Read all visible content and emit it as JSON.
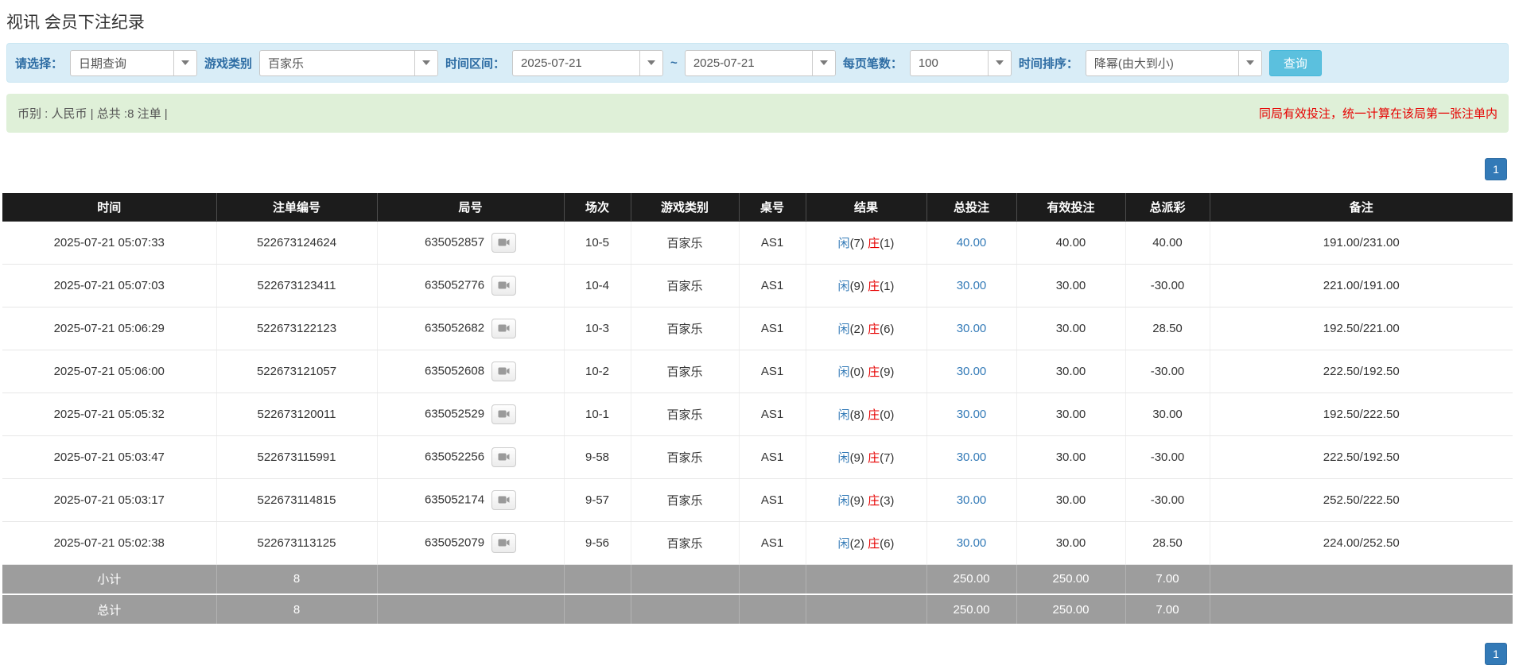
{
  "page": {
    "title": "视讯 会员下注纪录"
  },
  "filters": {
    "select_label": "请选择：",
    "select_value": "日期查询",
    "game_type_label": "游戏类别",
    "game_type_value": "百家乐",
    "date_range_label": "时间区间：",
    "date_from": "2025-07-21",
    "tilde": "~",
    "date_to": "2025-07-21",
    "page_size_label": "每页笔数：",
    "page_size_value": "100",
    "sort_label": "时间排序：",
    "sort_value": "降幂(由大到小)",
    "search_button": "查询"
  },
  "summary": {
    "left": "币别 : 人民币 | 总共 :8 注单 |",
    "right": "同局有效投注，统一计算在该局第一张注单内"
  },
  "pagination": {
    "page": "1"
  },
  "table": {
    "headers": [
      "时间",
      "注单编号",
      "局号",
      "场次",
      "游戏类别",
      "桌号",
      "结果",
      "总投注",
      "有效投注",
      "总派彩",
      "备注"
    ],
    "rows": [
      {
        "time": "2025-07-21 05:07:33",
        "bet_id": "522673124624",
        "round_id": "635052857",
        "session": "10-5",
        "game": "百家乐",
        "table_no": "AS1",
        "player": "闲",
        "player_score": "(7)",
        "banker": "庄",
        "banker_score": "(1)",
        "total_bet": "40.00",
        "valid_bet": "40.00",
        "payout": "40.00",
        "note": "191.00/231.00"
      },
      {
        "time": "2025-07-21 05:07:03",
        "bet_id": "522673123411",
        "round_id": "635052776",
        "session": "10-4",
        "game": "百家乐",
        "table_no": "AS1",
        "player": "闲",
        "player_score": "(9)",
        "banker": "庄",
        "banker_score": "(1)",
        "total_bet": "30.00",
        "valid_bet": "30.00",
        "payout": "-30.00",
        "note": "221.00/191.00"
      },
      {
        "time": "2025-07-21 05:06:29",
        "bet_id": "522673122123",
        "round_id": "635052682",
        "session": "10-3",
        "game": "百家乐",
        "table_no": "AS1",
        "player": "闲",
        "player_score": "(2)",
        "banker": "庄",
        "banker_score": "(6)",
        "total_bet": "30.00",
        "valid_bet": "30.00",
        "payout": "28.50",
        "note": "192.50/221.00"
      },
      {
        "time": "2025-07-21 05:06:00",
        "bet_id": "522673121057",
        "round_id": "635052608",
        "session": "10-2",
        "game": "百家乐",
        "table_no": "AS1",
        "player": "闲",
        "player_score": "(0)",
        "banker": "庄",
        "banker_score": "(9)",
        "total_bet": "30.00",
        "valid_bet": "30.00",
        "payout": "-30.00",
        "note": "222.50/192.50"
      },
      {
        "time": "2025-07-21 05:05:32",
        "bet_id": "522673120011",
        "round_id": "635052529",
        "session": "10-1",
        "game": "百家乐",
        "table_no": "AS1",
        "player": "闲",
        "player_score": "(8)",
        "banker": "庄",
        "banker_score": "(0)",
        "total_bet": "30.00",
        "valid_bet": "30.00",
        "payout": "30.00",
        "note": "192.50/222.50"
      },
      {
        "time": "2025-07-21 05:03:47",
        "bet_id": "522673115991",
        "round_id": "635052256",
        "session": "9-58",
        "game": "百家乐",
        "table_no": "AS1",
        "player": "闲",
        "player_score": "(9)",
        "banker": "庄",
        "banker_score": "(7)",
        "total_bet": "30.00",
        "valid_bet": "30.00",
        "payout": "-30.00",
        "note": "222.50/192.50"
      },
      {
        "time": "2025-07-21 05:03:17",
        "bet_id": "522673114815",
        "round_id": "635052174",
        "session": "9-57",
        "game": "百家乐",
        "table_no": "AS1",
        "player": "闲",
        "player_score": "(9)",
        "banker": "庄",
        "banker_score": "(3)",
        "total_bet": "30.00",
        "valid_bet": "30.00",
        "payout": "-30.00",
        "note": "252.50/222.50"
      },
      {
        "time": "2025-07-21 05:02:38",
        "bet_id": "522673113125",
        "round_id": "635052079",
        "session": "9-56",
        "game": "百家乐",
        "table_no": "AS1",
        "player": "闲",
        "player_score": "(2)",
        "banker": "庄",
        "banker_score": "(6)",
        "total_bet": "30.00",
        "valid_bet": "30.00",
        "payout": "28.50",
        "note": "224.00/252.50"
      }
    ],
    "subtotal": {
      "label": "小计",
      "count": "8",
      "total_bet": "250.00",
      "valid_bet": "250.00",
      "payout": "7.00"
    },
    "total": {
      "label": "总计",
      "count": "8",
      "total_bet": "250.00",
      "valid_bet": "250.00",
      "payout": "7.00"
    }
  }
}
